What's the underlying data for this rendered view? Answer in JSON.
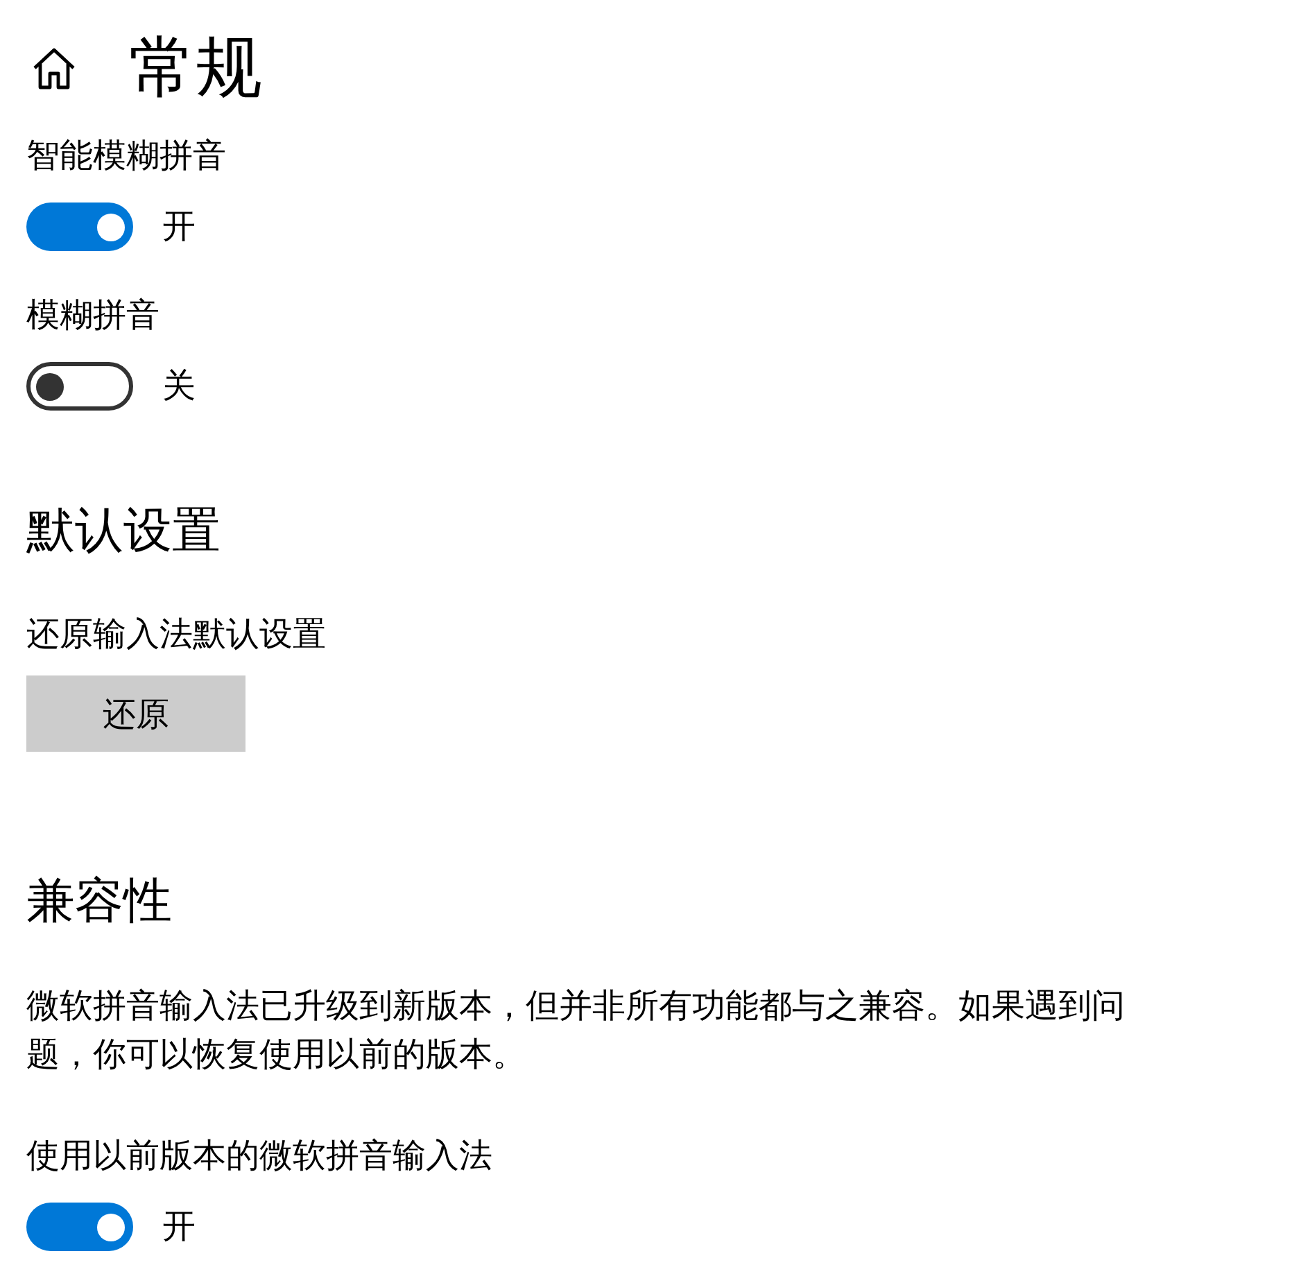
{
  "header": {
    "title": "常规"
  },
  "items": [
    {
      "kind": "toggle",
      "label": "智能模糊拼音",
      "on": true,
      "state_text": "开"
    },
    {
      "kind": "toggle",
      "label": "模糊拼音",
      "on": false,
      "state_text": "关"
    },
    {
      "kind": "heading",
      "text": "默认设置"
    },
    {
      "kind": "button",
      "label": "还原输入法默认设置",
      "button": "还原"
    },
    {
      "kind": "heading",
      "text": "兼容性"
    },
    {
      "kind": "paragraph",
      "text": "微软拼音输入法已升级到新版本，但并非所有功能都与之兼容。如果遇到问题，你可以恢复使用以前的版本。"
    },
    {
      "kind": "toggle",
      "label": "使用以前版本的微软拼音输入法",
      "on": true,
      "state_text": "开"
    }
  ]
}
